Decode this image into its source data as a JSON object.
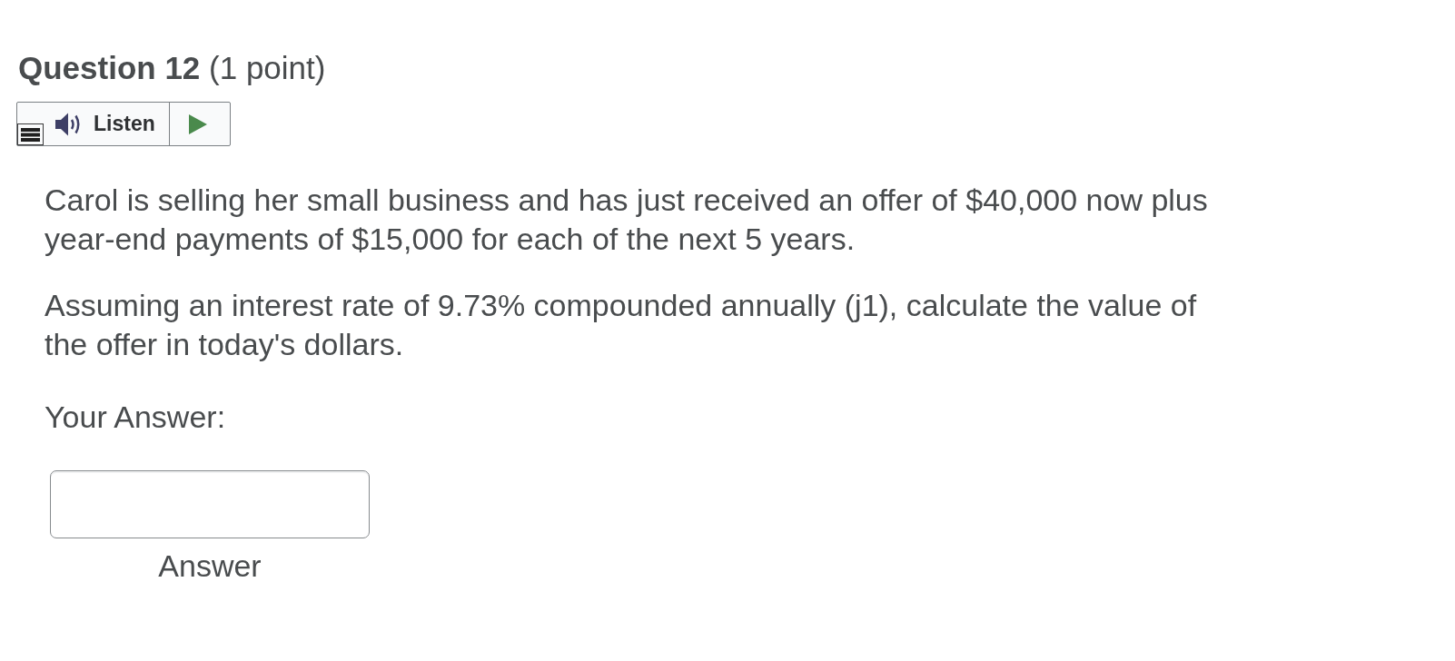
{
  "question": {
    "title": "**Question 12** (1 point)"
  },
  "listen": {
    "label": "Listen"
  },
  "paragraphs": [
    "Carol is selling her small business and has just received an offer of $40,000 now plus year-end payments of $15,000 for each of the next 5 years.",
    "Assuming an interest rate of 9.73% compounded annually (j1), calculate the value of the offer in today's dollars."
  ],
  "answer": {
    "prompt": "Your Answer:",
    "label": "Answer"
  }
}
